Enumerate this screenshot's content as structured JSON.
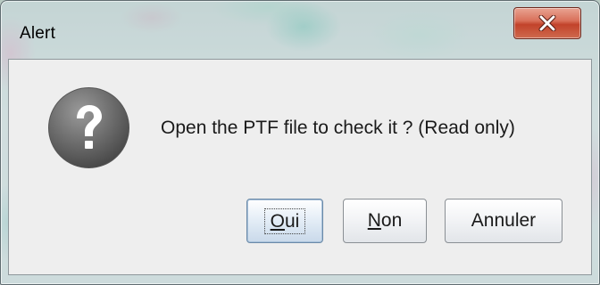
{
  "window": {
    "title": "Alert"
  },
  "dialog": {
    "icon": "question-icon",
    "message": "Open the PTF file to check it ? (Read only)"
  },
  "buttons": {
    "yes_label": "Oui",
    "no_label": "Non",
    "cancel_label": "Annuler"
  },
  "icons": {
    "close": "close-icon",
    "question": "question-icon"
  },
  "colors": {
    "close_button": "#c9553c",
    "dialog_background": "#eeeeee",
    "question_icon": "#6d6d6d"
  }
}
